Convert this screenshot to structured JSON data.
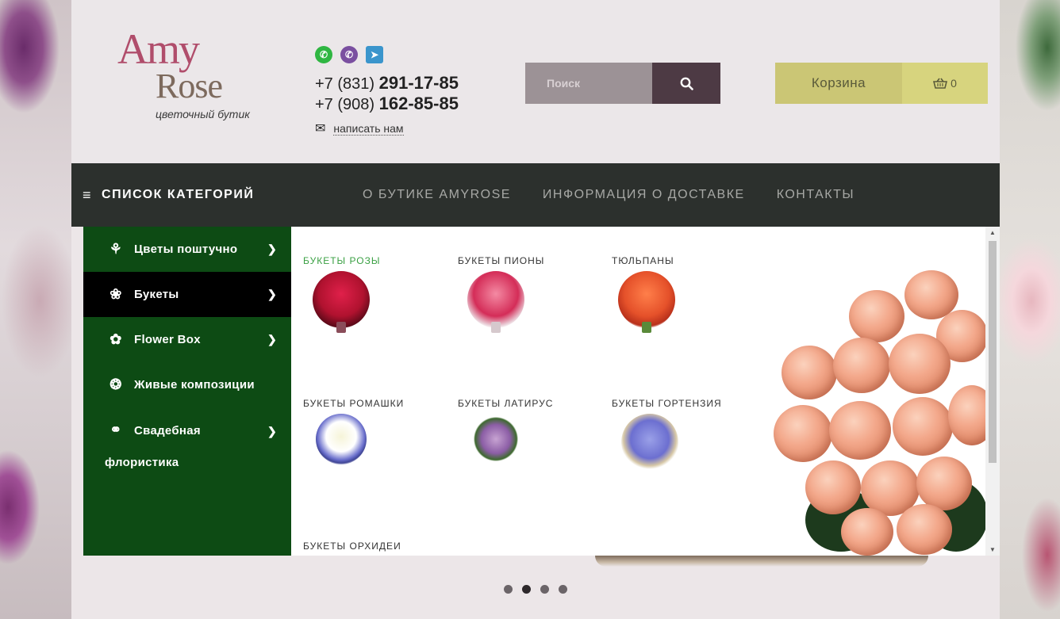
{
  "logo": {
    "line1": "Amy",
    "line2": "Rose",
    "tagline": "цветочный бутик"
  },
  "messengers": [
    {
      "name": "whatsapp",
      "glyph": "✆"
    },
    {
      "name": "viber",
      "glyph": "✆"
    },
    {
      "name": "telegram",
      "glyph": "➤"
    }
  ],
  "contacts": {
    "phone1_prefix": "+7 (831)",
    "phone1_number": "291-17-85",
    "phone2_prefix": "+7 (908)",
    "phone2_number": "162-85-85",
    "mail_label": "написать нам"
  },
  "search": {
    "placeholder": "Поиск"
  },
  "cart": {
    "label": "Корзина",
    "count": "0"
  },
  "nav": {
    "categories_label": "СПИСОК КАТЕГОРИЙ",
    "links": [
      "О БУТИКЕ AMYROSE",
      "ИНФОРМАЦИЯ О ДОСТАВКЕ",
      "КОНТАКТЫ"
    ]
  },
  "side_menu": [
    {
      "label": "Цветы поштучно",
      "has_arrow": true
    },
    {
      "label": "Букеты",
      "has_arrow": true,
      "active": true
    },
    {
      "label": "Flower Box",
      "has_arrow": true
    },
    {
      "label": "Живые композиции",
      "has_arrow": false
    },
    {
      "label": "Свадебная флористика",
      "has_arrow": true
    }
  ],
  "submenu": [
    {
      "title": "БУКЕТЫ РОЗЫ",
      "active": true
    },
    {
      "title": "БУКЕТЫ ПИОНЫ"
    },
    {
      "title": "ТЮЛЬПАНЫ"
    },
    {
      "title": "БУКЕТЫ РОМАШКИ"
    },
    {
      "title": "БУКЕТЫ ЛАТИРУС"
    },
    {
      "title": "БУКЕТЫ ГОРТЕНЗИЯ"
    },
    {
      "title": "БУКЕТЫ ОРХИДЕИ"
    }
  ],
  "slider": {
    "dot_count": 4,
    "active_index": 1
  },
  "colors": {
    "nav_bg": "#2c302d",
    "side_menu_bg": "#0d4b14",
    "active_item_bg": "#000000",
    "active_submenu_title": "#3aa043",
    "cart_bg": "#cbc675",
    "search_btn_bg": "#4d3a44"
  }
}
